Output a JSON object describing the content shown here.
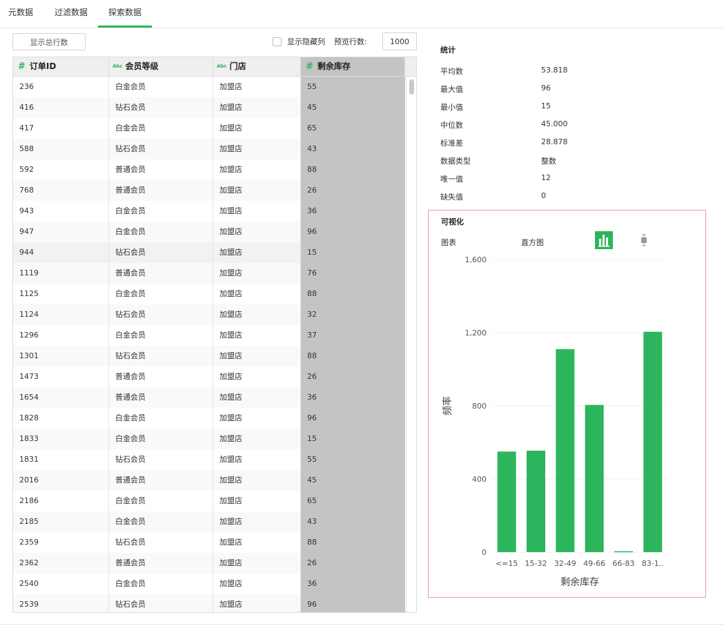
{
  "tabs": [
    {
      "label": "元数据",
      "active": false
    },
    {
      "label": "过滤数据",
      "active": false
    },
    {
      "label": "探索数据",
      "active": true
    }
  ],
  "toolbar": {
    "show_total_rows": "显示总行数",
    "show_hidden_columns": "显示隐藏列",
    "preview_rows_label": "预览行数:",
    "preview_rows_value": "1000"
  },
  "table": {
    "columns": [
      {
        "type_icon": "#",
        "name": "订单ID"
      },
      {
        "type_icon": "Abc",
        "name": "会员等级"
      },
      {
        "type_icon": "Abc",
        "name": "门店"
      },
      {
        "type_icon": "#",
        "name": "剩余库存"
      }
    ],
    "rows": [
      [
        "236",
        "白金会员",
        "加盟店",
        "55"
      ],
      [
        "416",
        "钻石会员",
        "加盟店",
        "45"
      ],
      [
        "417",
        "白金会员",
        "加盟店",
        "65"
      ],
      [
        "588",
        "钻石会员",
        "加盟店",
        "43"
      ],
      [
        "592",
        "普通会员",
        "加盟店",
        "88"
      ],
      [
        "768",
        "普通会员",
        "加盟店",
        "26"
      ],
      [
        "943",
        "白金会员",
        "加盟店",
        "36"
      ],
      [
        "947",
        "白金会员",
        "加盟店",
        "96"
      ],
      [
        "944",
        "钻石会员",
        "加盟店",
        "15"
      ],
      [
        "1119",
        "普通会员",
        "加盟店",
        "76"
      ],
      [
        "1125",
        "白金会员",
        "加盟店",
        "88"
      ],
      [
        "1124",
        "钻石会员",
        "加盟店",
        "32"
      ],
      [
        "1296",
        "白金会员",
        "加盟店",
        "37"
      ],
      [
        "1301",
        "钻石会员",
        "加盟店",
        "88"
      ],
      [
        "1473",
        "普通会员",
        "加盟店",
        "26"
      ],
      [
        "1654",
        "普通会员",
        "加盟店",
        "36"
      ],
      [
        "1828",
        "白金会员",
        "加盟店",
        "96"
      ],
      [
        "1833",
        "白金会员",
        "加盟店",
        "15"
      ],
      [
        "1831",
        "钻石会员",
        "加盟店",
        "55"
      ],
      [
        "2016",
        "普通会员",
        "加盟店",
        "45"
      ],
      [
        "2186",
        "白金会员",
        "加盟店",
        "65"
      ],
      [
        "2185",
        "白金会员",
        "加盟店",
        "43"
      ],
      [
        "2359",
        "钻石会员",
        "加盟店",
        "88"
      ],
      [
        "2362",
        "普通会员",
        "加盟店",
        "26"
      ],
      [
        "2540",
        "白金会员",
        "加盟店",
        "36"
      ],
      [
        "2539",
        "钻石会员",
        "加盟店",
        "96"
      ]
    ]
  },
  "stats": {
    "title": "统计",
    "items": [
      {
        "label": "平均数",
        "value": "53.818"
      },
      {
        "label": "最大值",
        "value": "96"
      },
      {
        "label": "最小值",
        "value": "15"
      },
      {
        "label": "中位数",
        "value": "45.000"
      },
      {
        "label": "标准差",
        "value": "28.878"
      },
      {
        "label": "数据类型",
        "value": "整数"
      },
      {
        "label": "唯一值",
        "value": "12"
      },
      {
        "label": "缺失值",
        "value": "0"
      }
    ]
  },
  "visualization": {
    "title": "可视化",
    "chart_label": "图表",
    "chart_type_label": "直方图",
    "icons": [
      "bar-chart-icon",
      "boxplot-icon"
    ]
  },
  "colors": {
    "accent": "#2db55d",
    "selected_column": "#c4c4c4",
    "highlight_border": "#e99a9a"
  },
  "chart_data": {
    "type": "bar",
    "categories": [
      "<=15",
      "15-32",
      "32-49",
      "49-66",
      "66-83",
      "83-1.."
    ],
    "values": [
      550,
      555,
      1110,
      805,
      5,
      1205
    ],
    "xlabel": "剩余库存",
    "ylabel": "频率",
    "ylim": [
      0,
      1600
    ],
    "yticks": [
      0,
      400,
      800,
      1200,
      1600
    ],
    "ytick_labels": [
      "0",
      "400",
      "800",
      "1,200",
      "1,600"
    ],
    "grid": true,
    "color": "#2db55d"
  }
}
